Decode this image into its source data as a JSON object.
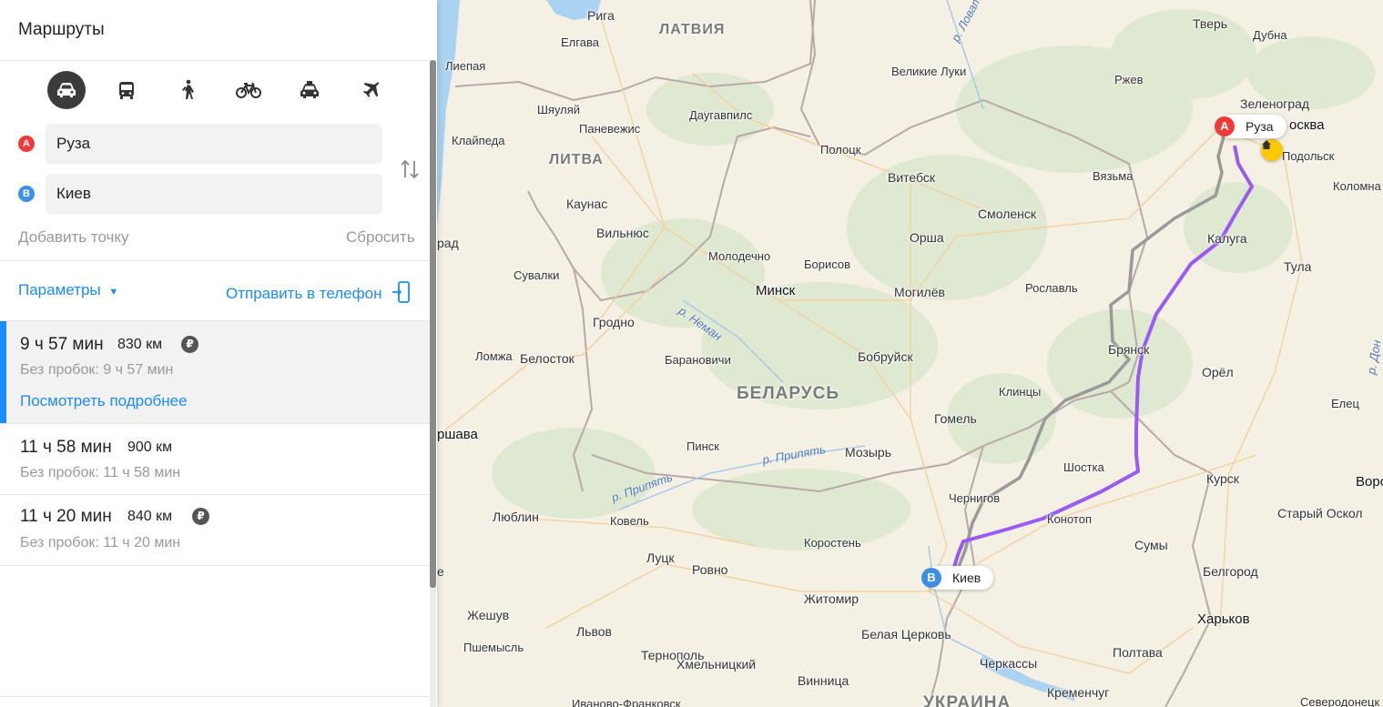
{
  "panel": {
    "title": "Маршруты",
    "modes": [
      {
        "name": "car-icon",
        "active": true
      },
      {
        "name": "bus-icon",
        "active": false
      },
      {
        "name": "walk-icon",
        "active": false
      },
      {
        "name": "bicycle-icon",
        "active": false
      },
      {
        "name": "taxi-icon",
        "active": false
      },
      {
        "name": "plane-icon",
        "active": false
      }
    ],
    "point_a": {
      "marker": "A",
      "value": "Руза",
      "color": "#f33a3a"
    },
    "point_b": {
      "marker": "B",
      "value": "Киев",
      "color": "#3d8fe6"
    },
    "add_point": "Добавить точку",
    "reset": "Сбросить",
    "params": "Параметры",
    "send_to_phone": "Отправить в телефон",
    "routes": [
      {
        "time": "9 ч 57 мин",
        "distance": "830 км",
        "toll": "₽",
        "no_traffic": "Без пробок: 9 ч 57 мин",
        "details": "Посмотреть подробнее",
        "active": true
      },
      {
        "time": "11 ч 58 мин",
        "distance": "900 км",
        "no_traffic": "Без пробок: 11 ч 58 мин",
        "active": false
      },
      {
        "time": "11 ч 20 мин",
        "distance": "840 км",
        "toll": "₽",
        "no_traffic": "Без пробок: 11 ч 20 мин",
        "active": false
      }
    ],
    "accent_color": "#1a8cff"
  },
  "map": {
    "route_color": "#9a5cf0",
    "alt_route_color": "#999999",
    "pin_a": {
      "marker": "A",
      "label": "Руза"
    },
    "pin_b": {
      "marker": "B",
      "label": "Киев"
    },
    "countries": [
      "ЛАТВИЯ",
      "ЛИТВА",
      "БЕЛАРУСЬ",
      "УКРАИНА"
    ],
    "rivers": [
      "р. Ловать",
      "р. Неман",
      "р. Припять",
      "р. Припять",
      "р. Дон"
    ],
    "cities": [
      "Рига",
      "Елгава",
      "Лиепая",
      "Шяуляй",
      "Паневежис",
      "Даугавпилс",
      "Клайпеда",
      "Каунас",
      "Вильнюс",
      "рад",
      "Сувалки",
      "Гродно",
      "Ломжа",
      "Белосток",
      "ршава",
      "Люблин",
      "Жешув",
      "Пшемысль",
      "Львов",
      "Тернополь",
      "Иваново-Франковск",
      "Ковель",
      "Луцк",
      "Ровно",
      "Хмельницкий",
      "Винница",
      "Житомир",
      "Коростень",
      "Белая Церковь",
      "Черкассы",
      "Кременчуг",
      "Полтава",
      "Харьков",
      "Белгород",
      "Сумы",
      "Конотоп",
      "Шостка",
      "Чернигов",
      "Мозырь",
      "Пинск",
      "Барановичи",
      "Минск",
      "Молодечно",
      "Борисов",
      "Бобруйск",
      "Могилёв",
      "Орша",
      "Витебск",
      "Полоцк",
      "Великие Луки",
      "Смоленск",
      "Рославль",
      "Брянск",
      "Клинцы",
      "Гомель",
      "Калуга",
      "Тула",
      "Орёл",
      "Курск",
      "Старый Оскол",
      "Воро",
      "Елец",
      "Коломна",
      "Подольск",
      "осква",
      "Зеленоград",
      "Тверь",
      "Дубна",
      "Ржев",
      "Вязьма",
      "Северодонецк",
      "е"
    ]
  }
}
